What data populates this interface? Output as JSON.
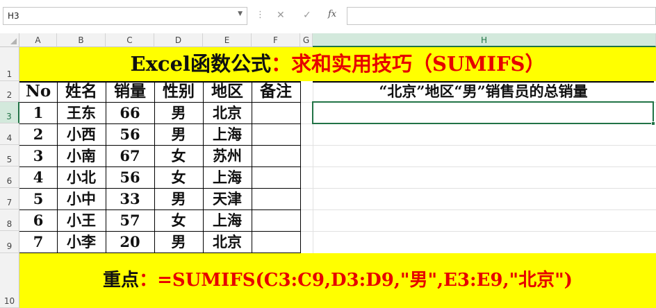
{
  "formula_bar": {
    "name_box": "H3",
    "cancel_icon": "✕",
    "enter_icon": "✓",
    "fx_label": "fx",
    "formula": ""
  },
  "columns": [
    "A",
    "B",
    "C",
    "D",
    "E",
    "F",
    "G",
    "H"
  ],
  "rows": [
    "1",
    "2",
    "3",
    "4",
    "5",
    "6",
    "7",
    "8",
    "9",
    "10"
  ],
  "title": {
    "black": "Excel函数公式",
    "red": "：求和实用技巧（SUMIFS）"
  },
  "table": {
    "headers": [
      "No",
      "姓名",
      "销量",
      "性别",
      "地区",
      "备注"
    ],
    "rows": [
      [
        "1",
        "王东",
        "66",
        "男",
        "北京",
        ""
      ],
      [
        "2",
        "小西",
        "56",
        "男",
        "上海",
        ""
      ],
      [
        "3",
        "小南",
        "67",
        "女",
        "苏州",
        ""
      ],
      [
        "4",
        "小北",
        "56",
        "女",
        "上海",
        ""
      ],
      [
        "5",
        "小中",
        "33",
        "男",
        "天津",
        ""
      ],
      [
        "6",
        "小王",
        "57",
        "女",
        "上海",
        ""
      ],
      [
        "7",
        "小李",
        "20",
        "男",
        "北京",
        ""
      ]
    ]
  },
  "question": "“北京”地区“男”销售员的总销量",
  "answer": "",
  "keypoint": {
    "black": "重点",
    "red": "：=SUMIFS(C3:C9,D3:D9,\"男\",E3:E9,\"北京\")"
  },
  "colors": {
    "yellow": "#ffff00",
    "red": "#e60000",
    "excel_green": "#217346"
  }
}
